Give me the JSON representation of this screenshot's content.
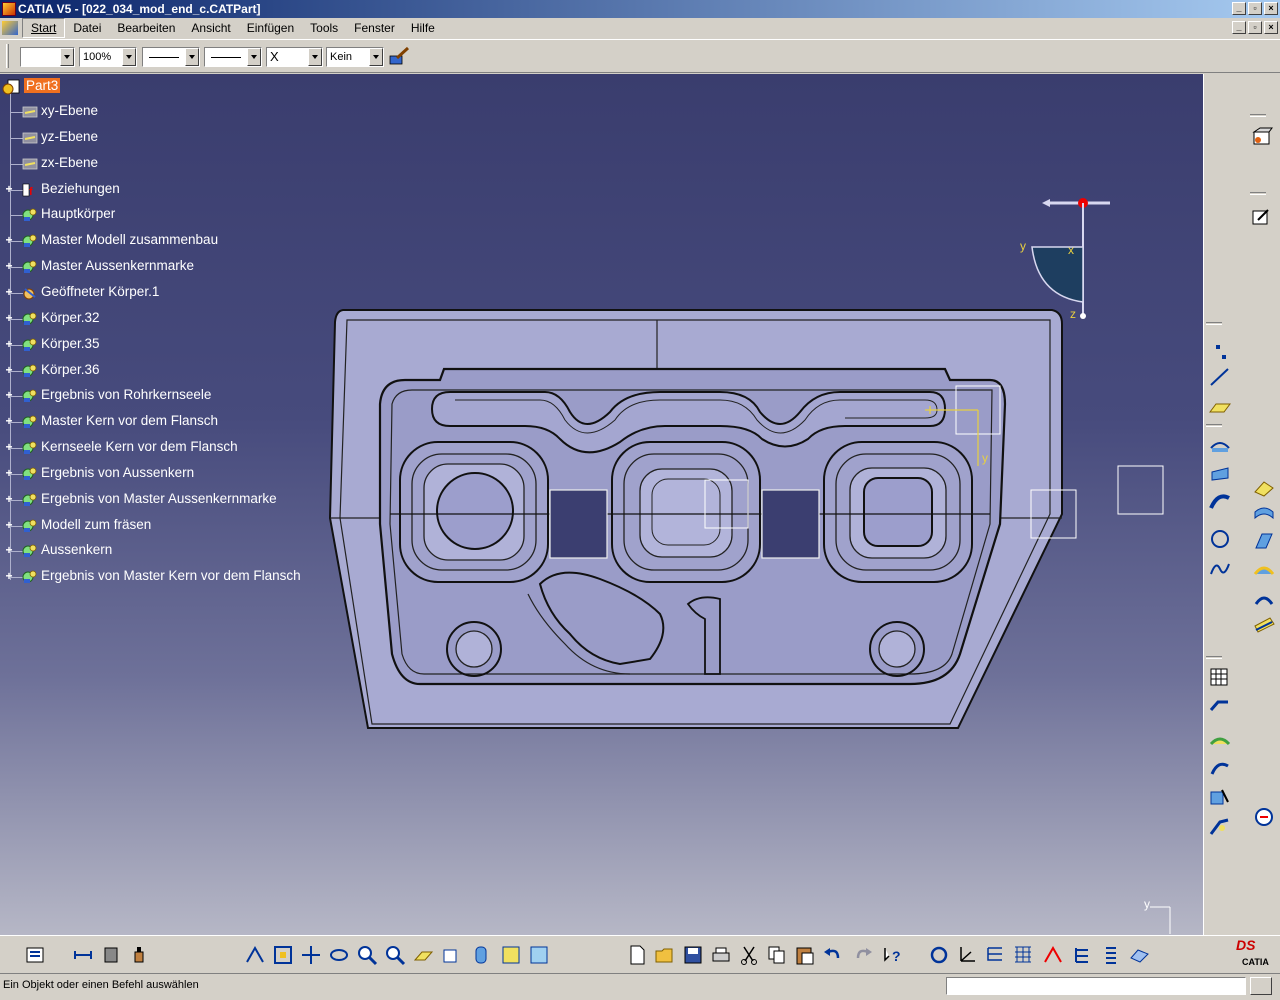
{
  "window": {
    "title": "CATIA V5 - [022_034_mod_end_c.CATPart]",
    "min": "_",
    "max": "▫",
    "close": "×"
  },
  "menu": [
    "Start",
    "Datei",
    "Bearbeiten",
    "Ansicht",
    "Einfügen",
    "Tools",
    "Fenster",
    "Hilfe"
  ],
  "graphic_props": {
    "zoom": "100%",
    "point_type": "X",
    "layer": "Kein"
  },
  "tree": {
    "root": "Part3",
    "items": [
      {
        "label": "xy-Ebene",
        "icon": "plane-icon",
        "expandable": false
      },
      {
        "label": "yz-Ebene",
        "icon": "plane-icon",
        "expandable": false
      },
      {
        "label": "zx-Ebene",
        "icon": "plane-icon",
        "expandable": false
      },
      {
        "label": "Beziehungen",
        "icon": "relations-icon",
        "expandable": true
      },
      {
        "label": "Hauptkörper",
        "icon": "body-icon",
        "expandable": false
      },
      {
        "label": "Master Modell zusammenbau",
        "icon": "body-icon",
        "expandable": true
      },
      {
        "label": "Master Aussenkernmarke",
        "icon": "body-icon",
        "expandable": true
      },
      {
        "label": "Geöffneter Körper.1",
        "icon": "open-body-icon",
        "expandable": true
      },
      {
        "label": "Körper.32",
        "icon": "body-icon",
        "expandable": true
      },
      {
        "label": "Körper.35",
        "icon": "body-icon",
        "expandable": true
      },
      {
        "label": "Körper.36",
        "icon": "body-icon",
        "expandable": true
      },
      {
        "label": "Ergebnis von  Rohrkernseele",
        "icon": "body-icon",
        "expandable": true
      },
      {
        "label": "Master Kern vor dem Flansch",
        "icon": "body-icon",
        "expandable": true
      },
      {
        "label": "Kernseele Kern vor dem Flansch",
        "icon": "body-icon",
        "expandable": true
      },
      {
        "label": "Ergebnis von  Aussenkern",
        "icon": "body-icon",
        "expandable": true
      },
      {
        "label": "Ergebnis von  Master Aussenkernmarke",
        "icon": "body-icon",
        "expandable": true
      },
      {
        "label": "Modell zum fräsen",
        "icon": "body-icon",
        "expandable": true
      },
      {
        "label": "Aussenkern",
        "icon": "body-icon",
        "expandable": true
      },
      {
        "label": "Ergebnis von  Master Kern vor dem Flansch",
        "icon": "body-icon",
        "expandable": true
      }
    ]
  },
  "compass": {
    "x": "x",
    "y": "y",
    "z": "z"
  },
  "axis_indicator": {
    "y": "y"
  },
  "feature_axis": {
    "y": "y"
  },
  "status": {
    "message": "Ein Objekt oder einen Befehl auswählen"
  },
  "logo": {
    "ds": "DS",
    "name": "CATIA"
  },
  "colors": {
    "accent": "#f07020",
    "viewport_top": "#3a3d6e",
    "part_fill": "#a8aad2"
  }
}
